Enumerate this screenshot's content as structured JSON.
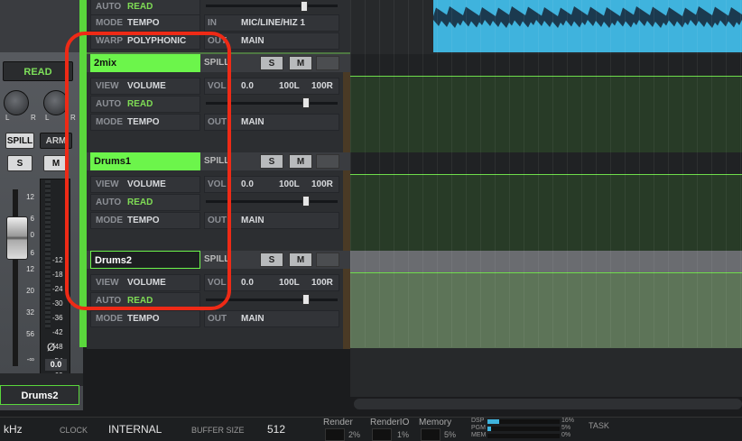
{
  "left_strip": {
    "automation_mode": "READ",
    "knob_labels": [
      "L",
      "R",
      "L",
      "R"
    ],
    "spill_label": "SPILL",
    "arm_label": "ARM",
    "solo_label": "S",
    "mute_label": "M",
    "fader_scale": [
      "12",
      "6",
      "0",
      "6",
      "12",
      "18",
      "24",
      "30",
      "36",
      "42",
      "48",
      "54",
      "60"
    ],
    "meter_scale_left": [
      "12",
      "6",
      "0",
      "6",
      "12",
      "20",
      "32",
      "56",
      "-∞"
    ],
    "meter_scale_right": [
      "-12",
      "-18",
      "-24",
      "-30",
      "-36",
      "-42",
      "-48",
      "-54",
      "-60"
    ],
    "phase_symbol": "Ø",
    "fader_value": "0.0",
    "channel_name": "Drums2"
  },
  "top_partial": {
    "auto_label": "AUTO",
    "auto_value": "READ",
    "mode_label": "MODE",
    "mode_value": "TEMPO",
    "warp_label": "WARP",
    "warp_value": "POLYPHONIC",
    "in_label": "IN",
    "in_value": "MIC/LINE/HIZ 1",
    "out_label": "OUT",
    "out_value": "MAIN"
  },
  "tracks": [
    {
      "name": "2mix",
      "spill": "SPILL",
      "solo": "S",
      "mute": "M",
      "view_label": "VIEW",
      "view_value": "VOLUME",
      "auto_label": "AUTO",
      "auto_value": "READ",
      "mode_label": "MODE",
      "mode_value": "TEMPO",
      "vol_label": "VOL",
      "vol_value": "0.0",
      "pan_left": "100L",
      "pan_right": "100R",
      "out_label": "OUT",
      "out_value": "MAIN"
    },
    {
      "name": "Drums1",
      "spill": "SPILL",
      "solo": "S",
      "mute": "M",
      "view_label": "VIEW",
      "view_value": "VOLUME",
      "auto_label": "AUTO",
      "auto_value": "READ",
      "mode_label": "MODE",
      "mode_value": "TEMPO",
      "vol_label": "VOL",
      "vol_value": "0.0",
      "pan_left": "100L",
      "pan_right": "100R",
      "out_label": "OUT",
      "out_value": "MAIN"
    },
    {
      "name": "Drums2",
      "spill": "SPILL",
      "solo": "S",
      "mute": "M",
      "view_label": "VIEW",
      "view_value": "VOLUME",
      "auto_label": "AUTO",
      "auto_value": "READ",
      "mode_label": "MODE",
      "mode_value": "TEMPO",
      "vol_label": "VOL",
      "vol_value": "0.0",
      "pan_left": "100L",
      "pan_right": "100R",
      "out_label": "OUT",
      "out_value": "MAIN"
    }
  ],
  "status_bar": {
    "sample_rate_unit": "kHz",
    "clock_label": "CLOCK",
    "clock_value": "INTERNAL",
    "buffer_label": "BUFFER SIZE",
    "buffer_value": "512",
    "render_label": "Render",
    "render_value": "2%",
    "renderio_label": "RenderIO",
    "renderio_value": "1%",
    "memory_label": "Memory",
    "memory_value": "5%",
    "dsp_label": "DSP",
    "dsp_value": "16%",
    "pgm_label": "PGM",
    "pgm_value": "5%",
    "mem_label": "MEM",
    "mem_value": "0%",
    "task_label": "TASK"
  },
  "colors": {
    "selected_track": "#6cf54b",
    "read_text": "#7fdc55",
    "annotation": "#ee2a16",
    "audio_clip": "#3fb3dd"
  }
}
